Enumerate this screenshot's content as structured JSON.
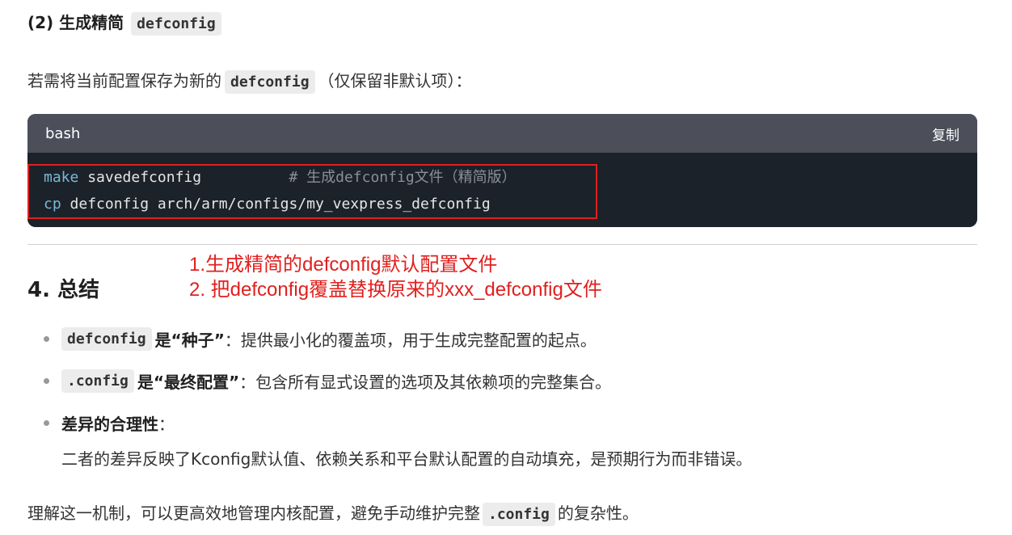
{
  "section3": {
    "heading_prefix": "(2) 生成精简",
    "heading_code": "defconfig"
  },
  "intro": {
    "prefix": "若需将当前配置保存为新的",
    "code": "defconfig",
    "suffix": "（仅保留非默认项）："
  },
  "codeblock": {
    "language": "bash",
    "copy_label": "复制",
    "lines": [
      {
        "cmd": "make",
        "rest": " savedefconfig          ",
        "comment": "# 生成defconfig文件（精简版）"
      },
      {
        "cmd": "cp",
        "rest": " defconfig arch/arm/configs/my_vexpress_defconfig",
        "comment": ""
      }
    ]
  },
  "annotation": {
    "line1": "1.生成精简的defconfig默认配置文件",
    "line2": "2. 把defconfig覆盖替换原来的xxx_defconfig文件"
  },
  "summary": {
    "heading": "4. 总结",
    "bullets": [
      {
        "code": "defconfig",
        "bold": "是“种子”",
        "text": "：提供最小化的覆盖项，用于生成完整配置的起点。"
      },
      {
        "code": ".config",
        "bold": "是“最终配置”",
        "text": "：包含所有显式设置的选项及其依赖项的完整集合。"
      },
      {
        "code": "",
        "bold": "差异的合理性",
        "text": "："
      }
    ],
    "sub_para": "二者的差异反映了Kconfig默认值、依赖关系和平台默认配置的自动填充，是预期行为而非错误。"
  },
  "closing": {
    "prefix": "理解这一机制，可以更高效地管理内核配置，避免手动维护完整",
    "code": ".config",
    "suffix": "的复杂性。"
  },
  "colors": {
    "annotation_red": "#e0201e",
    "code_bg": "#1c2229",
    "code_header_bg": "#4c4e5a",
    "keyword": "#79b8d9"
  }
}
